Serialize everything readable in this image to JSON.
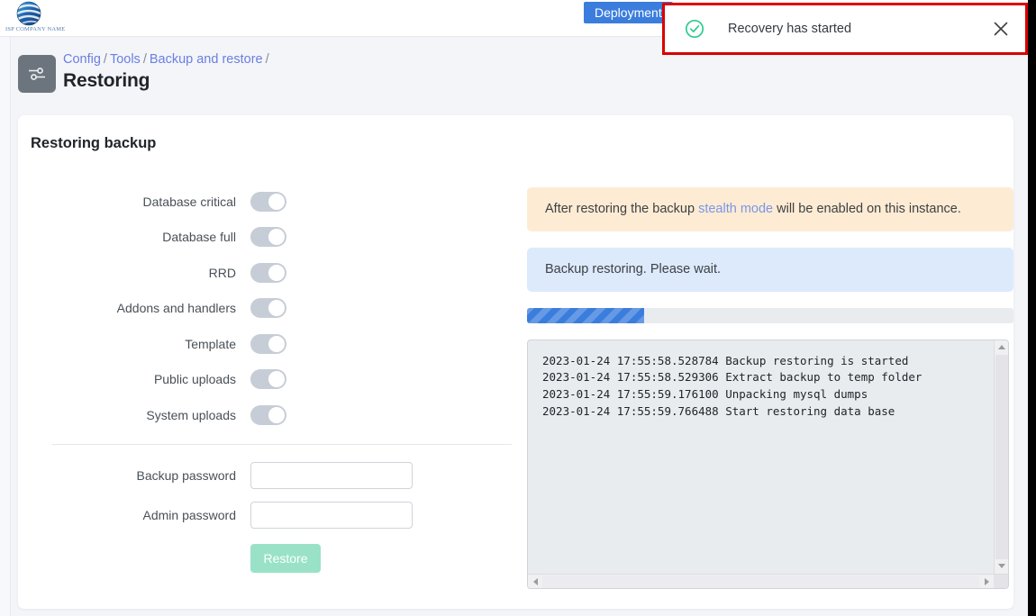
{
  "browser": {
    "chrome_visible": true
  },
  "topbar": {
    "logo_caption": "ISP COMPANY NAME",
    "logo_icon": "globe-logo-icon",
    "deployment_button_label": "Deployment"
  },
  "toast": {
    "icon": "check-circle-icon",
    "message": "Recovery has started",
    "close_icon": "close-icon",
    "highlight_color": "#e00000",
    "icon_color": "#2ecc91"
  },
  "header": {
    "page_icon": "sliders-icon",
    "breadcrumb": [
      {
        "label": "Config",
        "link": true
      },
      {
        "label": "Tools",
        "link": true
      },
      {
        "label": "Backup and restore",
        "link": true
      }
    ],
    "breadcrumb_separator": "/",
    "title": "Restoring"
  },
  "card": {
    "title": "Restoring backup"
  },
  "form": {
    "toggles": [
      {
        "label": "Database critical",
        "on": true,
        "disabled": true
      },
      {
        "label": "Database full",
        "on": true,
        "disabled": true
      },
      {
        "label": "RRD",
        "on": true,
        "disabled": true
      },
      {
        "label": "Addons and handlers",
        "on": true,
        "disabled": true
      },
      {
        "label": "Template",
        "on": true,
        "disabled": true
      },
      {
        "label": "Public uploads",
        "on": true,
        "disabled": true
      },
      {
        "label": "System uploads",
        "on": true,
        "disabled": true
      }
    ],
    "fields": [
      {
        "label": "Backup password",
        "value": "",
        "placeholder": ""
      },
      {
        "label": "Admin password",
        "value": "",
        "placeholder": ""
      }
    ],
    "submit_label": "Restore",
    "submit_disabled": true,
    "submit_color": "#99e2c8"
  },
  "status": {
    "warning_prefix": "After restoring the backup ",
    "warning_link": "stealth mode",
    "warning_suffix": " will be enabled on this instance.",
    "warning_bg": "#fdecd3",
    "info_text": "Backup restoring. Please wait.",
    "info_bg": "#dceafc",
    "progress_percent": 24,
    "progress_color": "#3b7ddd"
  },
  "log": {
    "lines": [
      "2023-01-24 17:55:58.528784 Backup restoring is started",
      "2023-01-24 17:55:58.529306 Extract backup to temp folder",
      "2023-01-24 17:55:59.176100 Unpacking mysql dumps",
      "2023-01-24 17:55:59.766488 Start restoring data base"
    ],
    "scroll_up_icon": "triangle-up-icon",
    "scroll_down_icon": "triangle-down-icon",
    "scroll_left_icon": "triangle-left-icon",
    "scroll_right_icon": "triangle-right-icon"
  }
}
